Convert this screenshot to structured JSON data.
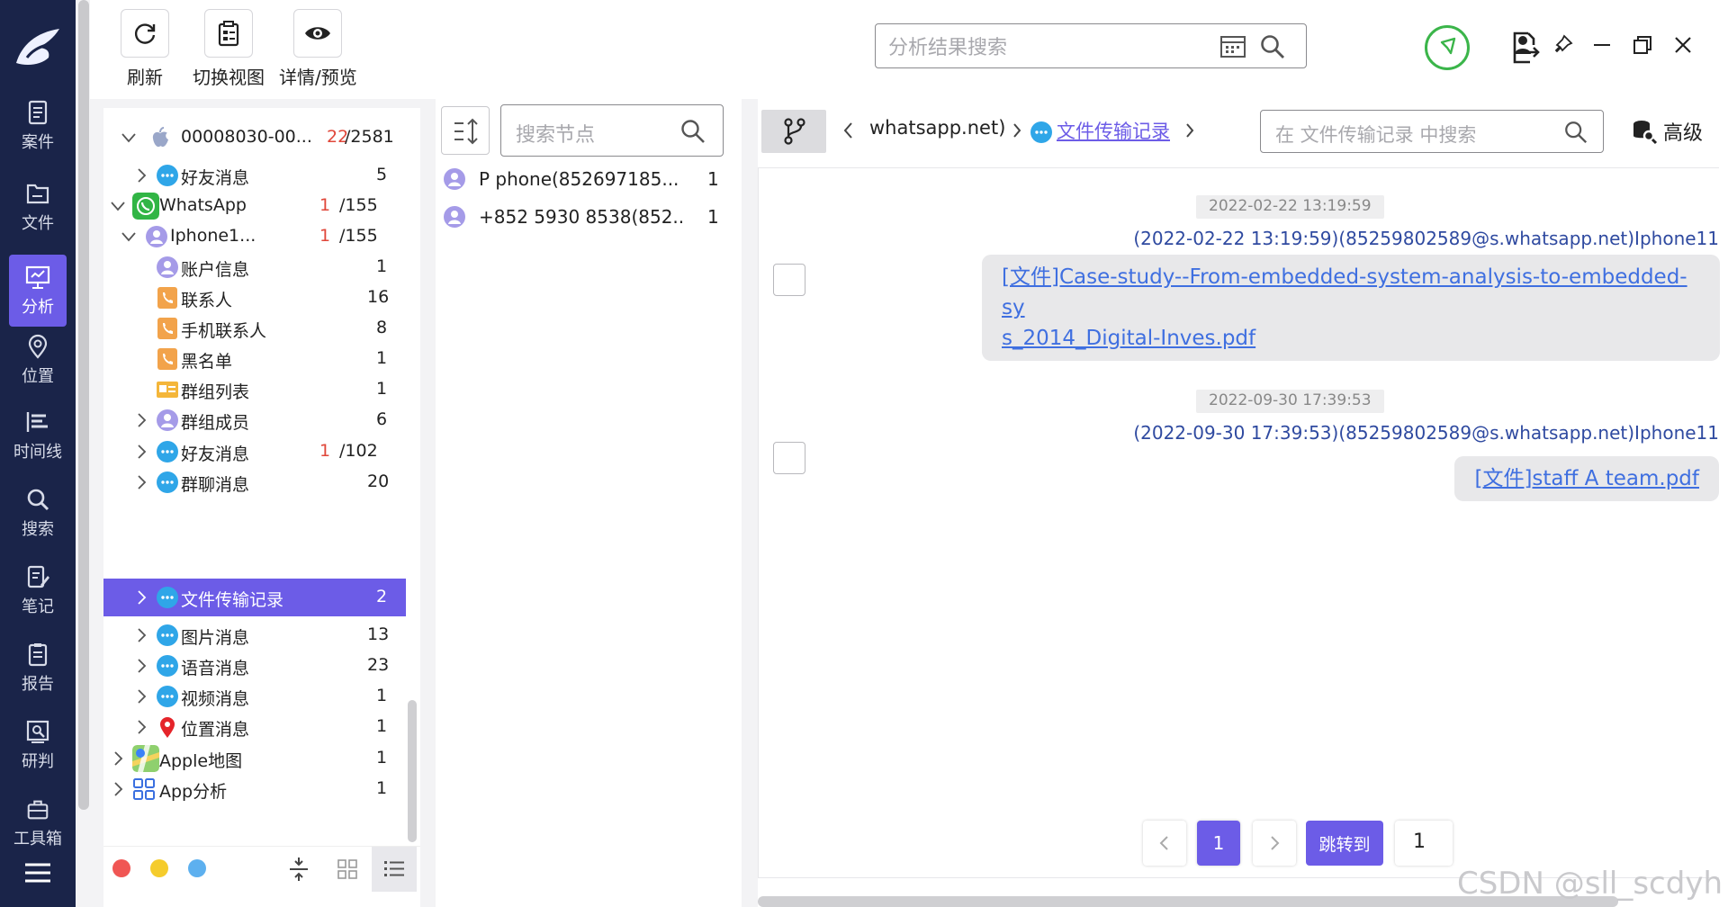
{
  "nav": {
    "items": [
      {
        "label": "案件",
        "icon": "case-icon"
      },
      {
        "label": "文件",
        "icon": "folder-icon"
      },
      {
        "label": "分析",
        "icon": "analysis-icon",
        "active": true
      },
      {
        "label": "位置",
        "icon": "location-icon"
      },
      {
        "label": "时间线",
        "icon": "timeline-icon"
      },
      {
        "label": "搜索",
        "icon": "search-icon"
      },
      {
        "label": "笔记",
        "icon": "note-icon"
      },
      {
        "label": "报告",
        "icon": "report-icon"
      },
      {
        "label": "研判",
        "icon": "judge-icon"
      },
      {
        "label": "工具箱",
        "icon": "toolbox-icon"
      }
    ]
  },
  "toolbar": {
    "refresh_label": "刷新",
    "switch_view_label": "切换视图",
    "detail_preview_label": "详情/预览",
    "search_placeholder": "分析结果搜索"
  },
  "tree": {
    "rows": [
      {
        "label": "00008030-00...",
        "red": "22",
        "count": "/2581",
        "icon": "apple-icon"
      },
      {
        "label": "好友消息",
        "count": "5",
        "icon": "chat-bubble-icon"
      },
      {
        "label": "WhatsApp",
        "red": "1",
        "count": "/155",
        "icon": "whatsapp-icon"
      },
      {
        "label": "Iphone1...",
        "red": "1",
        "count": "/155",
        "icon": "user-avatar-icon"
      },
      {
        "label": "账户信息",
        "count": "1",
        "icon": "account-icon"
      },
      {
        "label": "联系人",
        "count": "16",
        "icon": "contact-icon"
      },
      {
        "label": "手机联系人",
        "count": "8",
        "icon": "phone-contact-icon"
      },
      {
        "label": "黑名单",
        "count": "1",
        "icon": "blacklist-icon"
      },
      {
        "label": "群组列表",
        "count": "1",
        "icon": "group-list-icon"
      },
      {
        "label": "群组成员",
        "count": "6",
        "icon": "group-member-icon"
      },
      {
        "label": "好友消息",
        "red": "1",
        "count": "/102",
        "icon": "chat-bubble-icon"
      },
      {
        "label": "群聊消息",
        "count": "20",
        "icon": "chat-bubble-icon"
      },
      {
        "label": "文件传输记录",
        "count": "2",
        "icon": "chat-bubble-icon"
      },
      {
        "label": "图片消息",
        "count": "13",
        "icon": "chat-bubble-icon"
      },
      {
        "label": "语音消息",
        "count": "23",
        "icon": "chat-bubble-icon"
      },
      {
        "label": "视频消息",
        "count": "1",
        "icon": "chat-bubble-icon"
      },
      {
        "label": "位置消息",
        "count": "1",
        "icon": "location-pin-icon"
      },
      {
        "label": "Apple地图",
        "count": "1",
        "icon": "apple-maps-icon"
      },
      {
        "label": "App分析",
        "count": "1",
        "icon": "app-grid-icon"
      }
    ]
  },
  "nodes": {
    "search_placeholder": "搜索节点",
    "rows": [
      {
        "name": "P phone(852697185...",
        "count": "1"
      },
      {
        "name": "+852 5930 8538(852...",
        "count": "1"
      }
    ]
  },
  "crumbs": {
    "prev": "whatsapp.net)",
    "current": "文件传输记录",
    "search_placeholder": "在 文件传输记录 中搜索",
    "advanced_label": "高级"
  },
  "messages": [
    {
      "timestamp": "2022-02-22 13:19:59",
      "sender": "(2022-02-22 13:19:59)(85259802589@s.whatsapp.net)Iphone11",
      "line1": "[文件]Case-study--From-embedded-system-analysis-to-embedded-sy",
      "line2": "s_2014_Digital-Inves.pdf"
    },
    {
      "timestamp": "2022-09-30 17:39:53",
      "sender": "(2022-09-30 17:39:53)(85259802589@s.whatsapp.net)Iphone11",
      "line1": "[文件]staff A team.pdf"
    }
  ],
  "pager": {
    "current": "1",
    "jump_label": "跳转到",
    "jump_value": "1"
  },
  "watermark": "CSDN @sll_scdyh",
  "colors": {
    "accent": "#6c5ce7",
    "nav_bg": "#1a2449",
    "link": "#3f6fe0",
    "sender": "#2f4aa0"
  }
}
